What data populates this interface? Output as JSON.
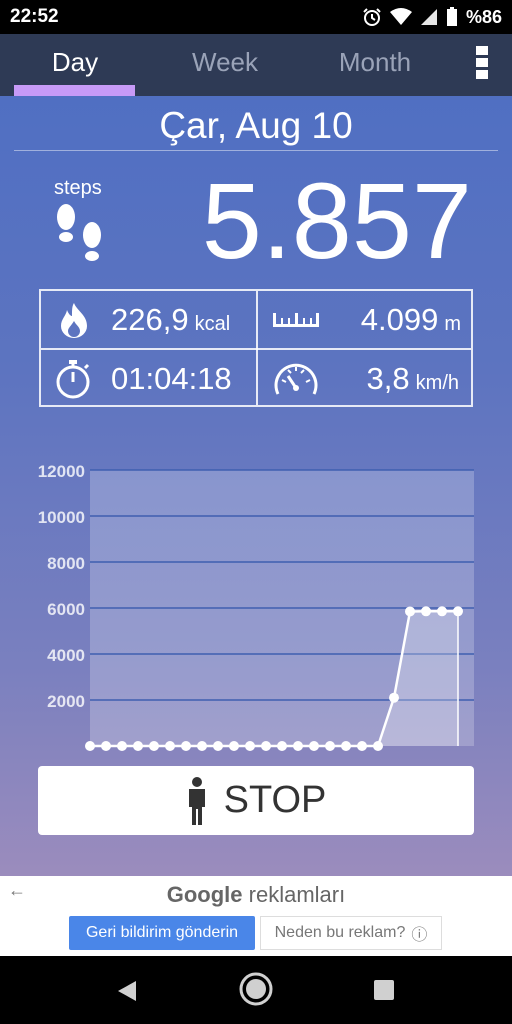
{
  "status": {
    "time": "22:52",
    "battery": "%86"
  },
  "tabs": [
    {
      "label": "Day"
    },
    {
      "label": "Week"
    },
    {
      "label": "Month"
    }
  ],
  "date": "Çar, Aug 10",
  "steps": {
    "label": "steps",
    "value": "5.857"
  },
  "stats": {
    "calories": {
      "value": "226,9",
      "unit": "kcal"
    },
    "distance": {
      "value": "4.099",
      "unit": "m"
    },
    "duration": {
      "value": "01:04:18"
    },
    "speed": {
      "value": "3,8",
      "unit": "km/h"
    }
  },
  "chart_data": {
    "type": "area",
    "x": [
      0,
      1,
      2,
      3,
      4,
      5,
      6,
      7,
      8,
      9,
      10,
      11,
      12,
      13,
      14,
      15,
      16,
      17,
      18,
      19,
      20,
      21,
      22,
      23
    ],
    "values": [
      0,
      0,
      0,
      0,
      0,
      0,
      0,
      0,
      0,
      0,
      0,
      0,
      0,
      0,
      0,
      0,
      0,
      0,
      0,
      2100,
      5850,
      5857,
      5857,
      5857
    ],
    "xticks": [
      "2",
      "4",
      "6",
      "8",
      "10",
      "12",
      "14",
      "16",
      "18",
      "20",
      "22",
      "24"
    ],
    "yticks": [
      "2000",
      "4000",
      "6000",
      "8000",
      "10000",
      "12000"
    ],
    "xlim": [
      0,
      24
    ],
    "ylim": [
      0,
      12000
    ],
    "grid": true
  },
  "stop_button": {
    "label": "STOP"
  },
  "ad": {
    "google": "Google",
    "title_suffix": "reklamları",
    "feedback_label": "Geri bildirim gönderin",
    "why_label": "Neden bu reklam?"
  }
}
